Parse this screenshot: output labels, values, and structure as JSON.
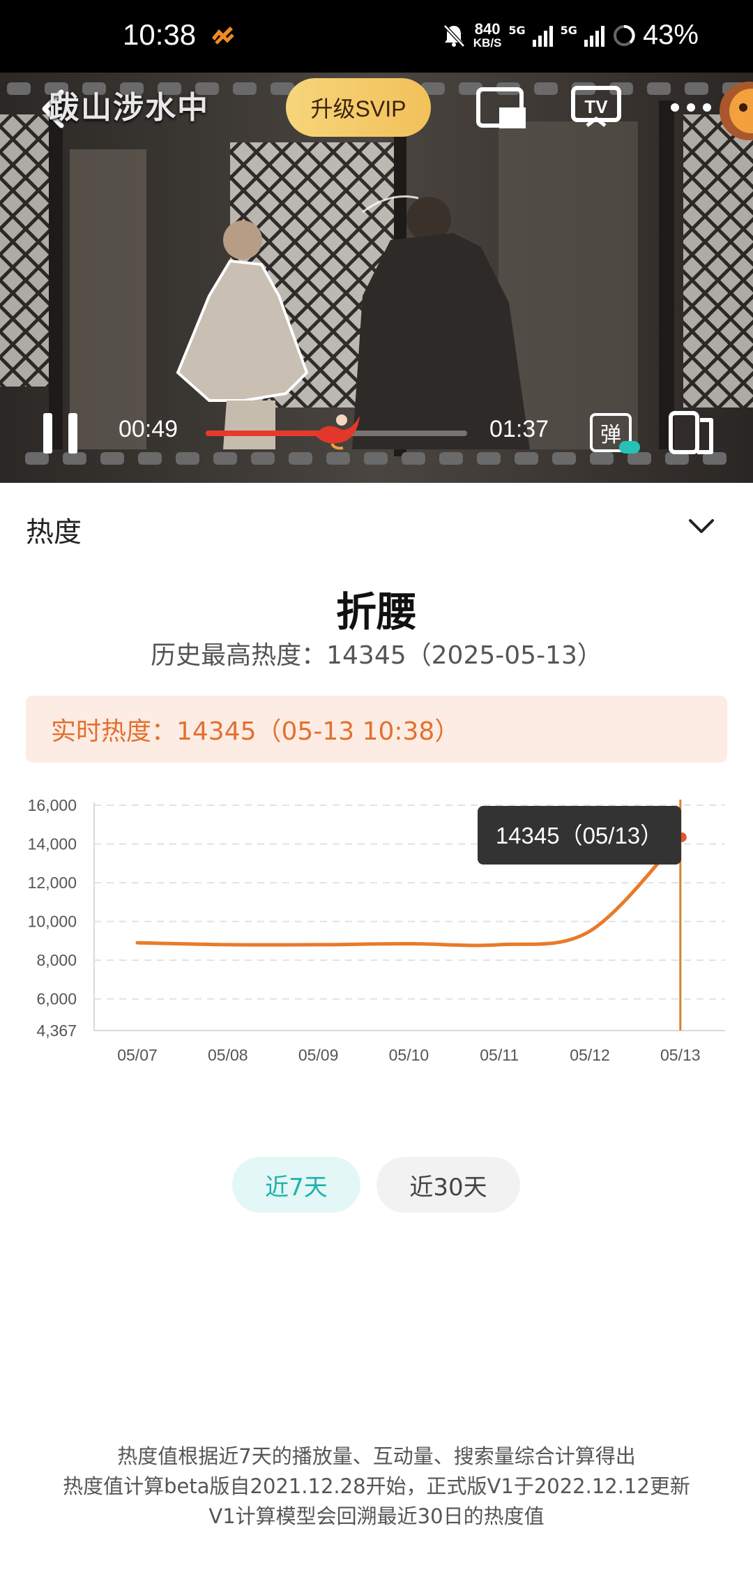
{
  "status_bar": {
    "time": "10:38",
    "net_speed_value": "840",
    "net_speed_unit": "KB/S",
    "sim1": "5G",
    "sim2": "5G",
    "battery": "43%"
  },
  "player": {
    "title": "跋山涉水中",
    "svip_label": "升级SVIP",
    "current_time": "00:49",
    "total_time": "01:37",
    "progress_fraction": 0.505,
    "danmu_label": "弹"
  },
  "heat_panel": {
    "header": "热度",
    "drama_title": "折腰",
    "history_high": "历史最高热度：14345（2025-05-13）",
    "realtime": "实时热度：14345（05-13 10:38）",
    "tooltip": "14345（05/13）",
    "range_buttons": [
      "近7天",
      "近30天"
    ],
    "active_range": 0
  },
  "chart_data": {
    "type": "line",
    "x": [
      "05/07",
      "05/08",
      "05/09",
      "05/10",
      "05/11",
      "05/12",
      "05/13"
    ],
    "series": [
      {
        "values": [
          8900,
          8800,
          8800,
          8850,
          8800,
          9500,
          14345
        ]
      }
    ],
    "y_ticks": [
      16000,
      14000,
      12000,
      10000,
      8000,
      6000,
      4367
    ],
    "y_tick_labels": [
      "16,000",
      "14,000",
      "12,000",
      "10,000",
      "8,000",
      "6,000",
      "4,367"
    ],
    "ylim": [
      4367,
      16000
    ],
    "grid": true,
    "line_color": "#e97a2a",
    "highlight_index": 6
  },
  "footnotes": [
    "热度值根据近7天的播放量、互动量、搜索量综合计算得出",
    "热度值计算beta版自2021.12.28开始，正式版V1于2022.12.12更新",
    "V1计算模型会回溯最近30日的热度值"
  ],
  "colors": {
    "accent_orange": "#e2702f",
    "teal": "#20b1ad",
    "svip_gold": "#f4cb66"
  }
}
